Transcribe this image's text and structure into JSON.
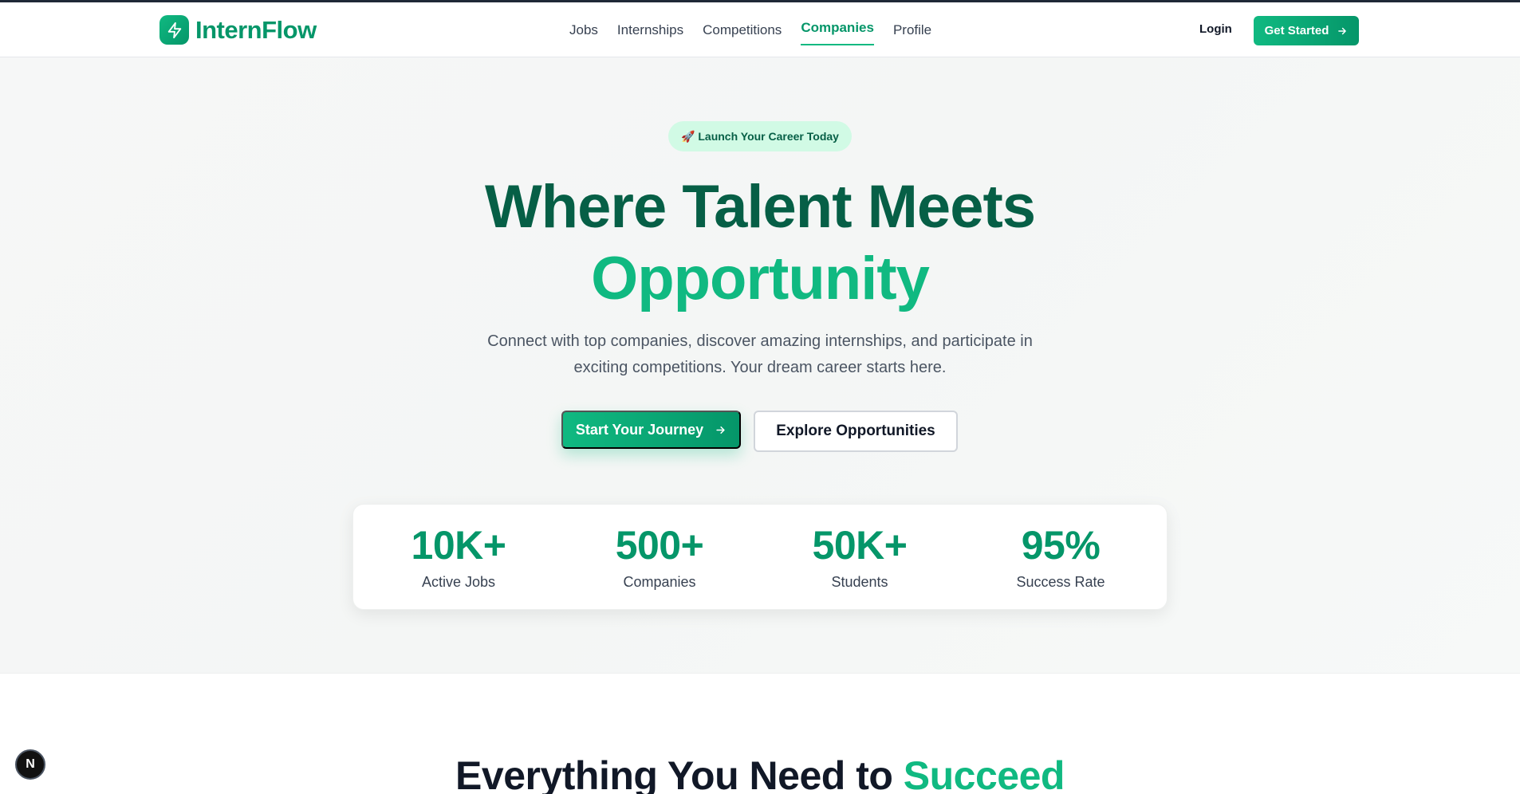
{
  "brand": {
    "name": "InternFlow",
    "logo_icon": "lightning-bolt-icon",
    "accent": "#10b981",
    "accent_dark": "#059669",
    "heading_dark": "#065f46"
  },
  "nav": {
    "links": [
      "Jobs",
      "Internships",
      "Competitions",
      "Companies",
      "Profile"
    ],
    "active": "Companies",
    "login": "Login",
    "get_started": "Get Started"
  },
  "hero": {
    "badge": "🚀 Launch Your Career Today",
    "title_line1": "Where Talent Meets",
    "title_line2": "Opportunity",
    "subtitle_line1": "Connect with top companies, discover amazing internships, and participate in",
    "subtitle_line2": "exciting competitions. Your dream career starts here.",
    "primary_cta": "Start Your Journey",
    "secondary_cta": "Explore Opportunities"
  },
  "stats": [
    {
      "value": "10K+",
      "label": "Active Jobs"
    },
    {
      "value": "500+",
      "label": "Companies"
    },
    {
      "value": "50K+",
      "label": "Students"
    },
    {
      "value": "95%",
      "label": "Success Rate"
    }
  ],
  "features": {
    "title_prefix": "Everything You Need to ",
    "title_accent": "Succeed"
  },
  "dev_badge": "N"
}
